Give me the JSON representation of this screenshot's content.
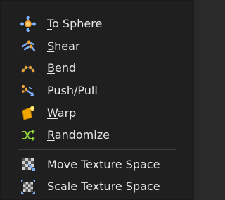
{
  "menu": {
    "items": [
      {
        "pre": "",
        "key": "T",
        "post": "o Sphere",
        "icon": "to-sphere-icon"
      },
      {
        "pre": "",
        "key": "S",
        "post": "hear",
        "icon": "shear-icon"
      },
      {
        "pre": "",
        "key": "B",
        "post": "end",
        "icon": "bend-icon"
      },
      {
        "pre": "",
        "key": "P",
        "post": "ush/Pull",
        "icon": "push-pull-icon"
      },
      {
        "pre": "",
        "key": "W",
        "post": "arp",
        "icon": "warp-icon"
      },
      {
        "pre": "",
        "key": "R",
        "post": "andomize",
        "icon": "randomize-icon"
      }
    ],
    "texture_items": [
      {
        "pre": "",
        "key": "M",
        "post": "ove Texture Space",
        "icon": "move-texture-space-icon"
      },
      {
        "pre": "S",
        "key": "c",
        "post": "ale Texture Space",
        "icon": "scale-texture-space-icon"
      }
    ]
  }
}
